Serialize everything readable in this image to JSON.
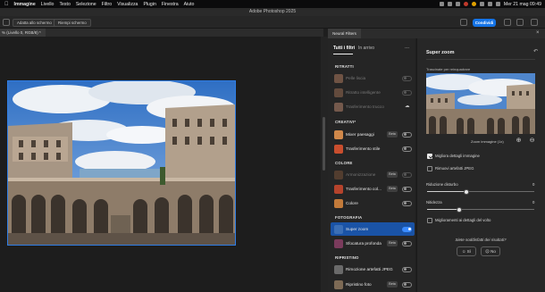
{
  "menubar": {
    "apple": "",
    "app": "Immagine",
    "items": [
      "Livello",
      "Testo",
      "Selezione",
      "Filtro",
      "Visualizza",
      "Plugin",
      "Finestra",
      "Aiuto"
    ],
    "clock": "Mer 21 mag 09:49"
  },
  "window": {
    "title": "Adobe Photoshop 2025"
  },
  "options": {
    "fit_label": "Adatta allo schermo",
    "fill_label": "Riempi schermo",
    "share_label": "Condividi"
  },
  "document": {
    "tab_label": "% (Livello 0, RGB/8) *"
  },
  "neural_filters": {
    "panel_title": "Neural Filters",
    "tabs": [
      "Tutti i filtri",
      "In arrivo"
    ],
    "more": "...",
    "sections": {
      "portraits": "RITRATTI",
      "creative": "CREATIVI*",
      "color": "COLORE",
      "photo": "FOTOGRAFIA",
      "restore": "RIPRISTINO"
    },
    "filters": [
      {
        "name": "Pelle liscia",
        "badge": "",
        "state": "off",
        "dim": true
      },
      {
        "name": "Ritratto intelligente",
        "badge": "",
        "state": "off",
        "dim": true
      },
      {
        "name": "Trasferimento trucco",
        "badge": "",
        "state": "cloud",
        "dim": true
      },
      {
        "name": "Mixer paesaggi",
        "badge": "Beta",
        "state": "off",
        "dim": false
      },
      {
        "name": "Trasferimento stile",
        "badge": "",
        "state": "off",
        "dim": false
      },
      {
        "name": "Armonizzazione",
        "badge": "Beta",
        "state": "off",
        "dim": true
      },
      {
        "name": "Trasferimento col...",
        "badge": "Beta",
        "state": "off",
        "dim": false
      },
      {
        "name": "Colore",
        "badge": "",
        "state": "off",
        "dim": false
      },
      {
        "name": "Super zoom",
        "badge": "",
        "state": "on",
        "dim": false
      },
      {
        "name": "Sfocatura profonda",
        "badge": "Beta",
        "state": "off",
        "dim": false
      },
      {
        "name": "Rimozione artefatti JPEG",
        "badge": "",
        "state": "off",
        "dim": false
      },
      {
        "name": "Ripristino foto",
        "badge": "Beta",
        "state": "off",
        "dim": false
      }
    ]
  },
  "super_zoom": {
    "title": "Super zoom",
    "subtitle": "Trascinate per reinquadrare",
    "zoom_label": "Zoom immagine (1x)",
    "options": [
      {
        "label": "Migliora dettagli immagine",
        "checked": true
      },
      {
        "label": "Rimuovi artefatti JPEG",
        "checked": false
      }
    ],
    "sliders": [
      {
        "label": "Riduzione disturbo",
        "value": "0",
        "fraction": 0.37
      },
      {
        "label": "Nitidezza",
        "value": "0",
        "fraction": 0.3
      }
    ],
    "face_detail": {
      "label": "Miglioramenti ai dettagli del volto",
      "checked": false
    },
    "feedback_question": "Siete soddisfatti dei risultati?",
    "yes_label": "Sì",
    "no_label": "No"
  }
}
